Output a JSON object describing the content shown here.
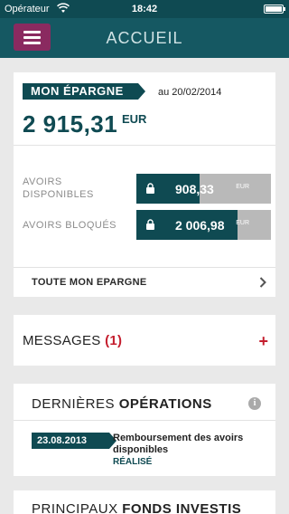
{
  "status_bar": {
    "carrier": "Opérateur",
    "time": "18:42"
  },
  "nav": {
    "title": "ACCUEIL",
    "menu_icon": "hamburger-icon"
  },
  "savings": {
    "tag": "MON ÉPARGNE",
    "as_of": "au 20/02/2014",
    "amount": "2 915,31",
    "currency": "EUR",
    "available": {
      "label_line1": "AVOIRS",
      "label_line2": "DISPONIBLES",
      "value": "908,33",
      "currency": "EUR",
      "fill_fraction": 0.47,
      "icon": "lock-icon"
    },
    "blocked": {
      "label": "AVOIRS BLOQUÉS",
      "value": "2 006,98",
      "currency": "EUR",
      "fill_fraction": 0.75,
      "icon": "lock-icon"
    },
    "link": "TOUTE MON EPARGNE"
  },
  "messages": {
    "label": "MESSAGES",
    "count": "(1)"
  },
  "operations": {
    "title_regular": "DERNIÈRES",
    "title_bold": "OPÉRATIONS",
    "item": {
      "date": "23.08.2013",
      "label": "Remboursement des avoirs disponibles",
      "status": "RÉALISÉ"
    }
  },
  "funds": {
    "title_regular": "PRINCIPAUX",
    "title_bold": "FONDS INVESTIS"
  },
  "colors": {
    "teal_dark": "#0f4a52",
    "teal_nav": "#155862",
    "menu_purple": "#8a2a60",
    "accent_red": "#c41e2e"
  }
}
